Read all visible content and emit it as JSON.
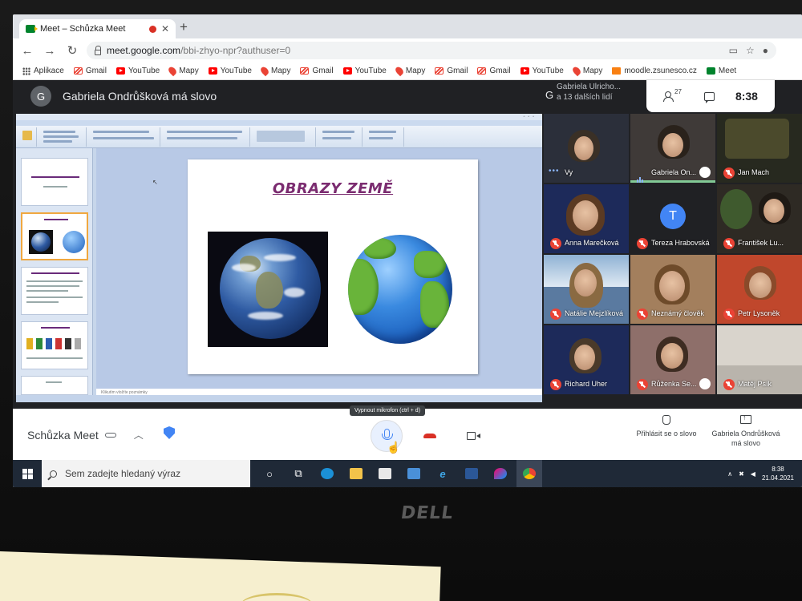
{
  "browser": {
    "tab_title": "Meet – Schůzka Meet",
    "url_host": "meet.google.com",
    "url_path": "/bbi-zhyo-npr?authuser=0",
    "bookmarks": [
      "Aplikace",
      "Gmail",
      "YouTube",
      "Mapy",
      "YouTube",
      "Mapy",
      "Gmail",
      "YouTube",
      "Mapy",
      "Gmail",
      "Gmail",
      "YouTube",
      "Mapy",
      "moodle.zsunesco.cz",
      "Meet"
    ]
  },
  "meet": {
    "presenter_initial": "G",
    "presenting_text": "Gabriela Ondrůšková má slovo",
    "present_info_initial": "G",
    "present_info_line1": "Gabriela Ulricho...",
    "present_info_line2": "a 13 dalších lidí",
    "people_count": "27",
    "clock": "8:38"
  },
  "slide": {
    "title": "OBRAZY ZEMĚ",
    "notes_placeholder": "Klikutím vložíte poznámky"
  },
  "participants": [
    {
      "name": "Vy"
    },
    {
      "name": "Gabriela On..."
    },
    {
      "name": "Jan Mach"
    },
    {
      "name": "Anna Marečková"
    },
    {
      "name": "Tereza Hrabovská",
      "initial": "T"
    },
    {
      "name": "František Lu..."
    },
    {
      "name": "Natálie Mejzlíková"
    },
    {
      "name": "Neznámý člověk"
    },
    {
      "name": "Petr Lysoněk"
    },
    {
      "name": "Richard Uher"
    },
    {
      "name": "Růženka Se..."
    },
    {
      "name": "Matěj Psík"
    }
  ],
  "controls": {
    "meeting_name": "Schůzka Meet",
    "mic_tooltip": "Vypnout mikrofon (ctrl + d)",
    "raise_hand": "Přihlásit se o slovo",
    "present_now": "Gabriela Ondrůšková má slovo"
  },
  "taskbar": {
    "search_placeholder": "Sem zadejte hledaný výraz",
    "time": "8:38",
    "date": "21.04.2021"
  },
  "laptop": {
    "brand": "DELL"
  }
}
